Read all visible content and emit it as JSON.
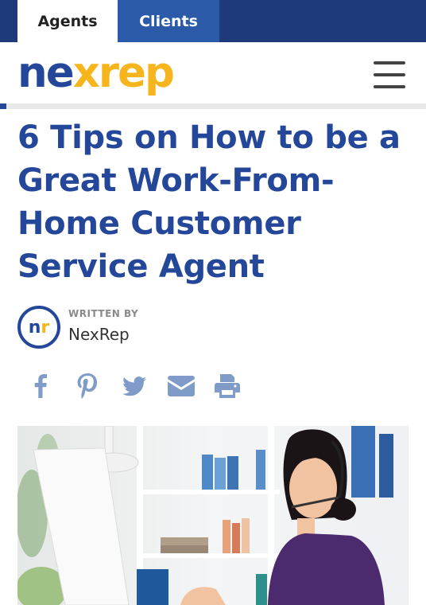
{
  "top_tabs": [
    {
      "label": "Agents"
    },
    {
      "label": "Clients"
    }
  ],
  "logo": {
    "text": "nexrep",
    "part1": "ne",
    "part2": "x",
    "part3": "rep"
  },
  "article": {
    "title": "6 Tips on How to be a Great Work-From-Home Customer Service Agent",
    "byline_label": "WRITTEN BY",
    "author": "NexRep",
    "avatar_initials": {
      "first": "n",
      "second": "r"
    }
  },
  "share_icons": [
    "facebook-icon",
    "pinterest-icon",
    "twitter-icon",
    "email-icon",
    "print-icon"
  ],
  "colors": {
    "brand_blue": "#24479a",
    "brand_yellow": "#f7b51d",
    "tab_blue": "#2a5aa8",
    "topbar": "#1f3a7a",
    "share_icon": "#7f9cc9"
  }
}
